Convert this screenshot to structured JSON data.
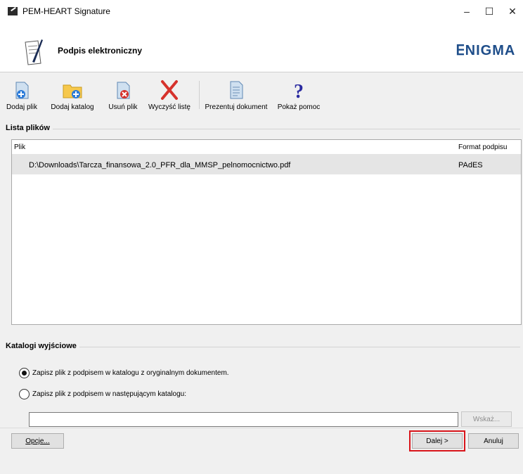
{
  "window": {
    "title": "PEM-HEART Signature",
    "min": "–",
    "max": "☐",
    "close": "✕"
  },
  "banner": {
    "title": "Podpis elektroniczny",
    "logo": "ENIGMA"
  },
  "toolbar": {
    "add_file": "Dodaj plik",
    "add_folder": "Dodaj katalog",
    "remove_file": "Usuń plik",
    "clear_list": "Wyczyść listę",
    "present_doc": "Prezentuj dokument",
    "show_help": "Pokaż pomoc"
  },
  "file_list": {
    "group_label": "Lista plików",
    "columns": {
      "file": "Plik",
      "format": "Format podpisu"
    },
    "rows": [
      {
        "path": "D:\\Downloads\\Tarcza_finansowa_2.0_PFR_dla_MMSP_pelnomocnictwo.pdf",
        "format": "PAdES"
      }
    ]
  },
  "output": {
    "group_label": "Katalogi wyjściowe",
    "option_original": "Zapisz plik z podpisem w katalogu z oryginalnym dokumentem.",
    "option_custom": "Zapisz plik z podpisem w następującym katalogu:",
    "path_value": "",
    "browse_label": "Wskaż..."
  },
  "footer": {
    "options_label": "Opcje...",
    "next_label": "Dalej >",
    "cancel_label": "Anuluj"
  },
  "colors": {
    "highlight": "#d9151b",
    "logo": "#1f4e8a",
    "selected_row": "#e5e5e5"
  }
}
